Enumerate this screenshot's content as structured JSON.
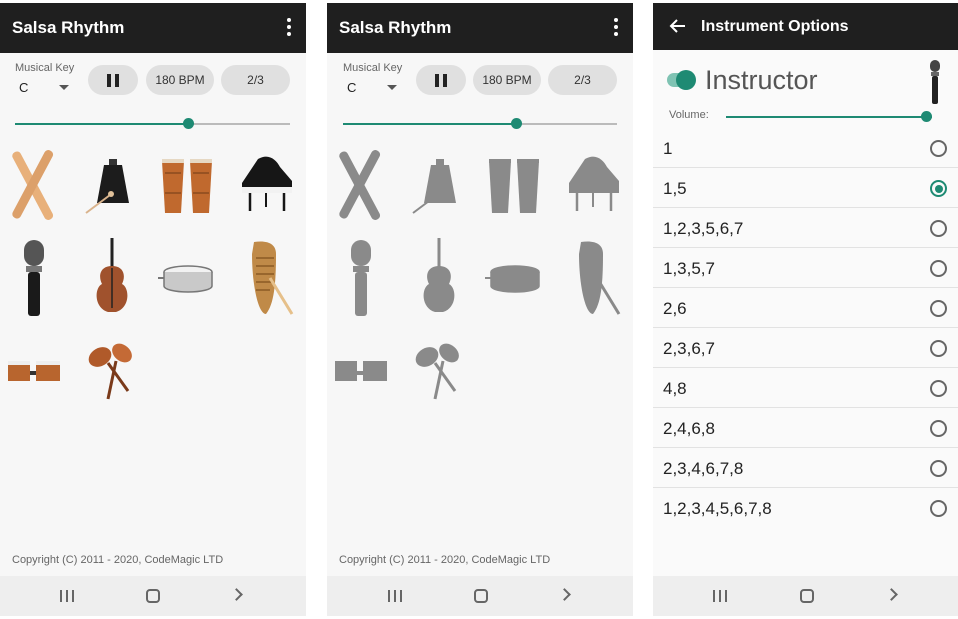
{
  "screen_main": {
    "title": "Salsa Rhythm",
    "musical_key_label": "Musical Key",
    "musical_key_value": "C",
    "tempo_label": "180 BPM",
    "time_sig_label": "2/3",
    "tempo_slider_level": 0.63,
    "copyright": "Copyright (C) 2011 - 2020, CodeMagic LTD"
  },
  "screen_muted": {
    "title": "Salsa Rhythm",
    "musical_key_label": "Musical Key",
    "musical_key_value": "C",
    "tempo_label": "180 BPM",
    "time_sig_label": "2/3",
    "tempo_slider_level": 0.63,
    "copyright": "Copyright (C) 2011 - 2020, CodeMagic LTD"
  },
  "instruments": [
    "claves-icon",
    "cowbell-icon",
    "congas-icon",
    "piano-icon",
    "microphone-icon",
    "double-bass-icon",
    "timbale-icon",
    "guiro-icon",
    "bongos-icon",
    "maracas-icon"
  ],
  "instrument_options": {
    "title": "Instrument Options",
    "instructor_label": "Instructor",
    "instructor_enabled": true,
    "volume_label": "Volume:",
    "volume_level": 1.0,
    "options": [
      "1",
      "1,5",
      "1,2,3,5,6,7",
      "1,3,5,7",
      "2,6",
      "2,3,6,7",
      "4,8",
      "2,4,6,8",
      "2,3,4,6,7,8",
      "1,2,3,4,5,6,7,8"
    ],
    "selected_index": 1
  },
  "colors": {
    "accent": "#1e8a73",
    "appbar": "#1f1f1f",
    "muted_instrument": "#8a8a8a"
  }
}
